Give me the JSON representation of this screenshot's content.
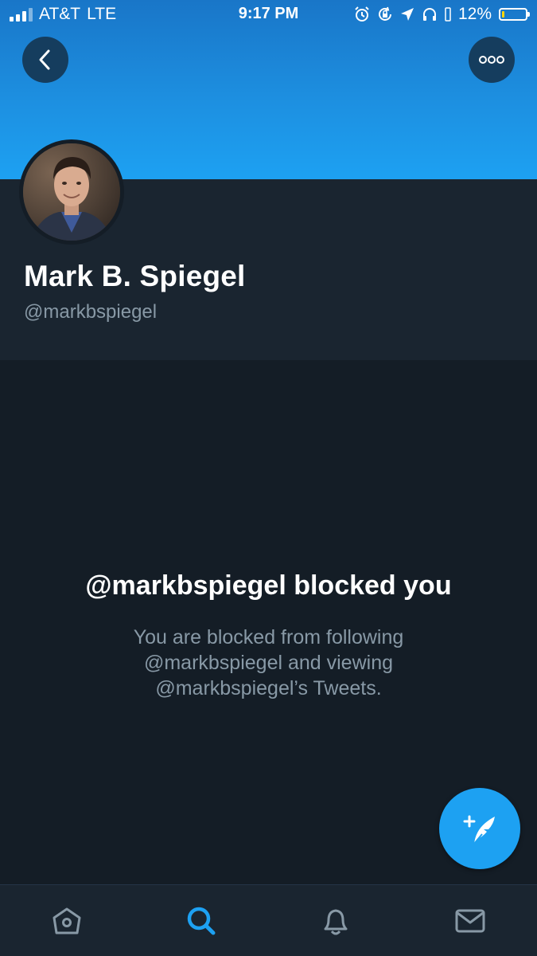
{
  "status_bar": {
    "carrier": "AT&T",
    "network": "LTE",
    "time": "9:17 PM",
    "battery_percent": "12%",
    "battery_level": 0.12,
    "icons": [
      "alarm-icon",
      "rotation-lock-icon",
      "location-icon",
      "headphones-icon",
      "battery-icon"
    ]
  },
  "header": {
    "back_icon": "chevron-left-icon",
    "more_icon": "more-dots-icon"
  },
  "profile": {
    "display_name": "Mark B. Spiegel",
    "handle": "@markbspiegel"
  },
  "blocked": {
    "title": "@markbspiegel blocked you",
    "description": "You are blocked from following @markbspiegel and viewing @markbspiegel’s Tweets."
  },
  "fab": {
    "icon": "compose-tweet-icon"
  },
  "tabs": [
    {
      "name": "home",
      "icon": "home-icon",
      "active": false
    },
    {
      "name": "search",
      "icon": "search-icon",
      "active": true
    },
    {
      "name": "notifications",
      "icon": "bell-icon",
      "active": false
    },
    {
      "name": "messages",
      "icon": "mail-icon",
      "active": false
    }
  ],
  "colors": {
    "accent": "#1da1f2",
    "background": "#141d26",
    "panel": "#1a2530",
    "secondary_text": "#8899a6"
  }
}
